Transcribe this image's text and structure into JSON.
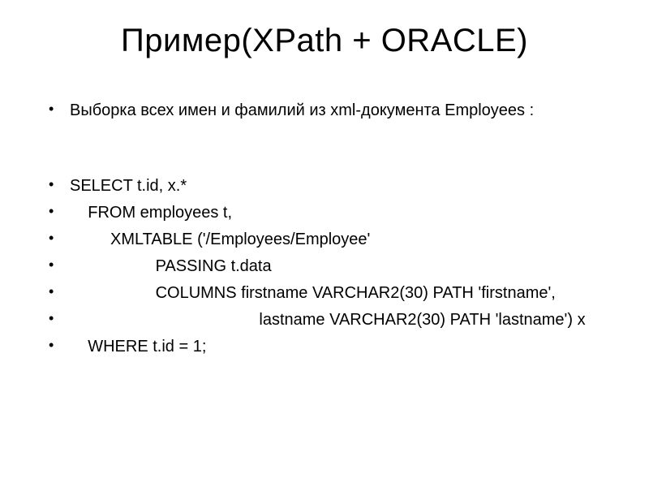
{
  "title": "Пример(XPath + ORACLE)",
  "lines": {
    "l0": "Выборка всех имен и фамилий из xml-документа Employees :",
    "l1": "SELECT t.id, x.*",
    "l2": "    FROM employees t,",
    "l3": "         XMLTABLE ('/Employees/Employee'",
    "l4": "                   PASSING t.data",
    "l5": "                   COLUMNS firstname VARCHAR2(30) PATH 'firstname',",
    "l6": "                                          lastname VARCHAR2(30) PATH 'lastname') x",
    "l7": "    WHERE t.id = 1;"
  }
}
